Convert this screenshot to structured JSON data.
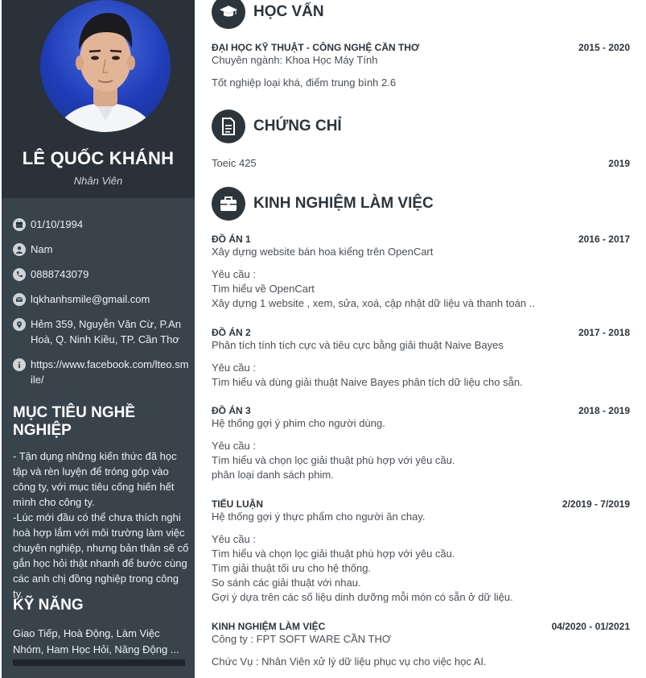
{
  "profile": {
    "name": "LÊ QUỐC KHÁNH",
    "position": "Nhân Viên"
  },
  "contacts": [
    {
      "icon": "calendar-icon",
      "text": "01/10/1994"
    },
    {
      "icon": "user-icon",
      "text": "Nam"
    },
    {
      "icon": "phone-icon",
      "text": "0888743079"
    },
    {
      "icon": "email-icon",
      "text": "lqkhanhsmile@gmail.com"
    },
    {
      "icon": "location-icon",
      "text": "Hẻm 359, Nguyễn Văn Cừ, P.An Hoà, Q. Ninh Kiều, TP. Cần Thơ"
    },
    {
      "icon": "info-icon",
      "text": "https://www.facebook.com/lteo.smile/"
    }
  ],
  "objective": {
    "heading": "MỤC TIÊU NGHỀ NGHIỆP",
    "text": "- Tận dụng những kiến thức đã học tập và rèn luyện để tróng góp vào công ty, với mục tiêu cống hiến hết mình cho công ty.\n-Lúc mới đầu có thể chưa thích nghi hoà hợp lắm với môi trường làm việc chuyên nghiệp, nhưng bản thân sẽ cố gắn học hỏi thật nhanh để bước cùng các anh chị đồng nghiệp trong công ty."
  },
  "skills": {
    "heading": "KỸ NĂNG",
    "text": "Giao Tiếp, Hoà Động, Làm Việc Nhóm, Ham Học Hỏi, Năng Động ..."
  },
  "education": {
    "heading": "HỌC VẤN",
    "school": "ĐẠI HỌC KỸ THUẬT - CÔNG NGHỆ CẦN THƠ",
    "date": "2015 - 2020",
    "major": "Chuyên ngành: Khoa Học Máy Tính",
    "result": "Tốt nghiệp loại khá, điểm trung bình 2.6"
  },
  "certificates": {
    "heading": "CHỨNG CHỈ",
    "name": "Toeic 425",
    "date": "2019"
  },
  "experience": {
    "heading": "KINH NGHIỆM LÀM VIỆC",
    "p1": {
      "title": "ĐỒ ÁN 1",
      "date": "2016 - 2017",
      "desc": "Xây dựng website bán hoa kiểng trên OpenCart",
      "req": "Yêu cầu :",
      "l1": "Tìm hiểu về OpenCart",
      "l2": "Xây dựng 1 website , xem, sửa, xoá, cập nhật dữ liệu và thanh toán .."
    },
    "p2": {
      "title": "ĐỒ ÁN 2",
      "date": "2017 - 2018",
      "desc": "Phân tích tính tích cực và tiêu cực bằng giải thuật Naive Bayes",
      "req": "Yêu cầu :",
      "l1": "Tìm hiểu và dùng giải thuật  Naive Bayes phân tích dữ liệu cho sẵn."
    },
    "p3": {
      "title": "ĐỒ ÁN 3",
      "date": "2018 - 2019",
      "desc": "Hệ thống gợi ý phim cho người dùng.",
      "req": "Yêu cầu :",
      "l1": "Tìm hiểu và chọn lọc giải thuật phù hợp với yêu cầu.",
      "l2": "phân loại danh sách phim."
    },
    "p4": {
      "title": "TIỂU LUẬN",
      "date": "2/2019 - 7/2019",
      "desc": "Hệ thống gợi ý thực phẩm cho người ăn chay.",
      "req": "Yêu cầu :",
      "l1": "Tìm hiểu và chọn lọc giải thuật phù hợp với yêu cầu.",
      "l2": "Tìm giải thuật tối ưu cho hệ thống.",
      "l3": "So sánh các giải thuật với nhau.",
      "l4": "Gợi ý dựa trên các số liệu dinh dưỡng mỗi món có sẵn ở dữ liệu."
    },
    "job": {
      "title": "KINH NGHIỆM LÀM VIỆC",
      "date": "04/2020 - 01/2021",
      "company": "Công ty : FPT SOFT WARE CẦN THƠ",
      "role": "Chức Vụ : Nhân Viên xử lý dữ liệu phục vụ cho việc học AI."
    }
  }
}
